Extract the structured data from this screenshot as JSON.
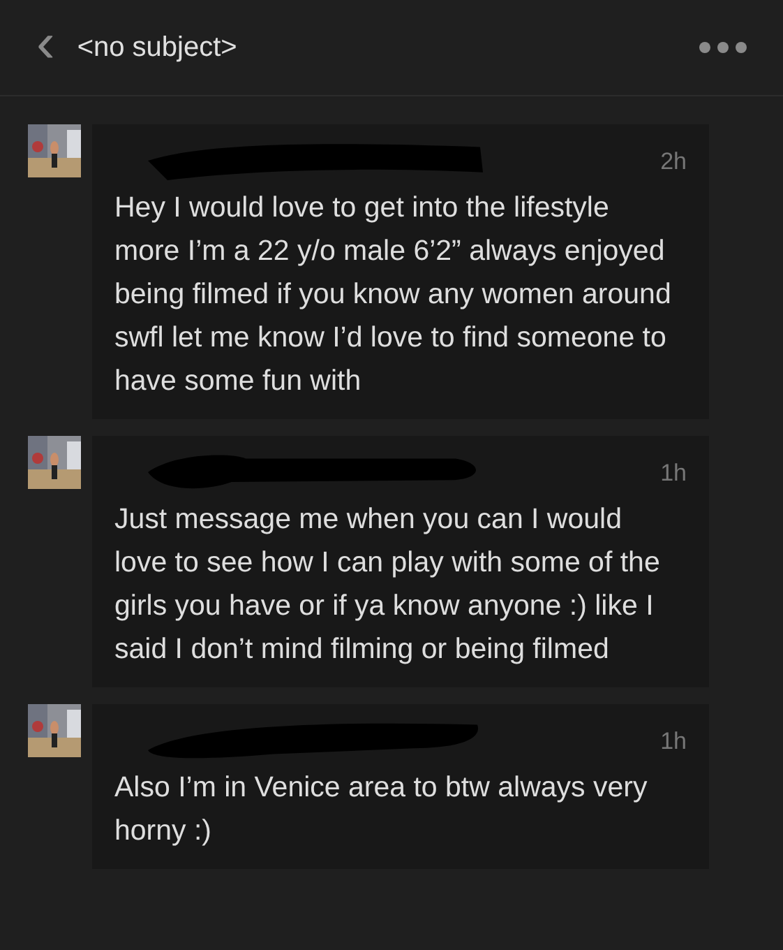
{
  "header": {
    "back": "‹",
    "title": "<no subject>"
  },
  "messages": [
    {
      "time": "2h",
      "text": "Hey I would love to get into the lifestyle more I’m a 22 y/o male 6’2” always enjoyed being filmed if you know any women around swfl let me know I’d love to find someone to have some fun with"
    },
    {
      "time": "1h",
      "text": "Just message me when you can I would love to see how I can play with some of the girls you have or if ya know anyone :) like I said I don’t mind filming or being filmed"
    },
    {
      "time": "1h",
      "text": "Also I’m in Venice area to btw always very horny :)"
    }
  ]
}
